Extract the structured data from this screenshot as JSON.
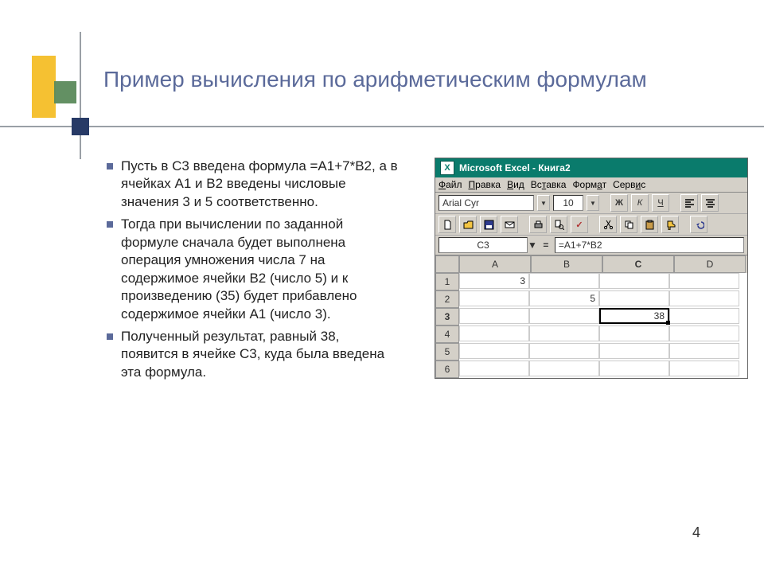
{
  "title": "Пример вычисления по арифметическим формулам",
  "bullets": [
    "Пусть в С3 введена формула =А1+7*В2, а в ячейках А1 и В2 введены числовые значения 3 и 5 соответственно.",
    "Тогда при вычислении по заданной формуле сначала будет выполнена операция умножения числа 7 на содержимое ячейки В2 (число 5) и к произведению (35) будет прибавлено содержимое ячейки А1 (число 3).",
    "Полученный результат, равный 38, появится в ячейке С3, куда была введена эта формула."
  ],
  "excel": {
    "title": "Microsoft Excel - Книга2",
    "menus": [
      "Файл",
      "Правка",
      "Вид",
      "Вставка",
      "Формат",
      "Сервис"
    ],
    "menus_underline_index": [
      0,
      0,
      0,
      2,
      4,
      4
    ],
    "font_name": "Arial Cyr",
    "font_size": "10",
    "bold": "Ж",
    "italic": "К",
    "underline": "Ч",
    "name_box": "C3",
    "formula": "=A1+7*B2",
    "columns": [
      "A",
      "B",
      "C",
      "D"
    ],
    "active_col_index": 2,
    "rows": [
      1,
      2,
      3,
      4,
      5,
      6
    ],
    "active_row_index": 2,
    "cells": {
      "A1": "3",
      "B2": "5",
      "C3": "38"
    }
  },
  "page_number": "4"
}
